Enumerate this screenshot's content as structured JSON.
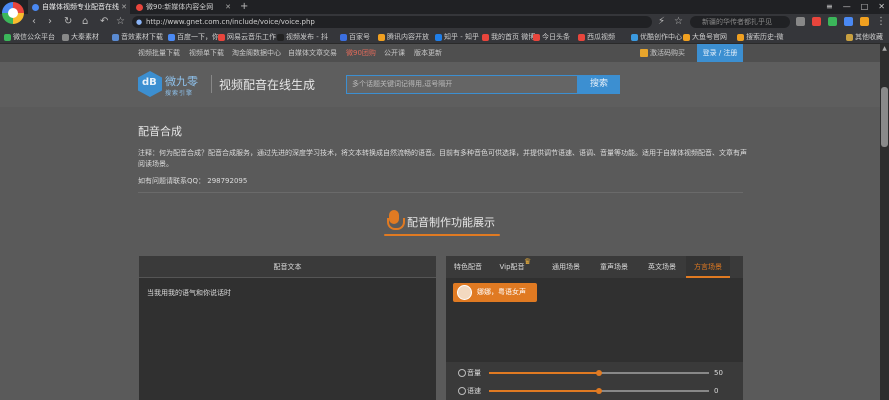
{
  "browser": {
    "tabs": [
      {
        "label": "自媒体视频专业配音在线",
        "active": true
      },
      {
        "label": "微90:新媒体内容全网",
        "active": false
      }
    ],
    "url": "http://www.gnet.com.cn/include/voice/voice.php",
    "search_placeholder": "新疆的华传者都扎乎见",
    "bookmarks": [
      {
        "label": "微信公众平台",
        "color": "#3bb65a"
      },
      {
        "label": "大秦素材",
        "color": "#888888"
      },
      {
        "label": "音效素材下载",
        "color": "#5a8ad1"
      },
      {
        "label": "百度一下，你",
        "color": "#4a89f3"
      },
      {
        "label": "网易云音乐工作",
        "color": "#e8453c"
      },
      {
        "label": "视频发布 - 抖",
        "color": "#222222"
      },
      {
        "label": "百家号",
        "color": "#3b6fe0"
      },
      {
        "label": "腾讯内容开放",
        "color": "#f0a020"
      },
      {
        "label": "知乎 - 知乎",
        "color": "#1f7ee8"
      },
      {
        "label": "我的首页 微博",
        "color": "#e8453c"
      },
      {
        "label": "今日头条",
        "color": "#e8453c"
      },
      {
        "label": "西瓜视频",
        "color": "#e8453c"
      },
      {
        "label": "优酷创作中心",
        "color": "#3b9ae0"
      },
      {
        "label": "大鱼号官网",
        "color": "#f0a020"
      },
      {
        "label": "搜索历史-微",
        "color": "#f0a020"
      },
      {
        "label": "其他收藏",
        "color": "#c8a040"
      }
    ]
  },
  "site": {
    "top_links": [
      {
        "label": "视频批量下载",
        "hot": false
      },
      {
        "label": "视频单下载",
        "hot": false
      },
      {
        "label": "淘金阁数据中心",
        "hot": false
      },
      {
        "label": "自媒体文章交易",
        "hot": false
      },
      {
        "label": "微90团购",
        "hot": true
      },
      {
        "label": "公开课",
        "hot": false
      },
      {
        "label": "版本更新",
        "hot": false
      }
    ],
    "vip_label": "激活码购买",
    "login_label": "登录 / 注册",
    "brand_name": "微九零",
    "brand_sub": "搜索引擎",
    "page_title": "视频配音在线生成",
    "search_placeholder": "多个话题关键词记得用,逗号隔开",
    "search_button": "搜索"
  },
  "content": {
    "section_title": "配音合成",
    "note": "注释：何为配音合成？配音合成服务，通过先进的深度学习技术，将文本转换成自然流畅的语音。目前有多种音色可供选择，并提供调节语速、语调、音量等功能。适用于自媒体视频配音、文章有声阅读场景。",
    "contact": "如有问题请联系QQ： 298792095",
    "feature_title": "配音制作功能展示",
    "text_panel_title": "配音文本",
    "text_panel_content": "当我用我的语气和你说话时",
    "voice_tabs": [
      {
        "label": "特色配音",
        "active": false
      },
      {
        "label": "Vip配音",
        "active": false
      },
      {
        "label": "通用场景",
        "active": false
      },
      {
        "label": "童声场景",
        "active": false
      },
      {
        "label": "英文场景",
        "active": false
      },
      {
        "label": "方言场景",
        "active": true
      }
    ],
    "selected_voice": "娜娜，粤语女声",
    "sliders": [
      {
        "label": "音量",
        "value": 50,
        "max": 100
      },
      {
        "label": "语速",
        "value": 0,
        "min": -500,
        "max": 500
      }
    ]
  },
  "colors": {
    "accent": "#e07a22",
    "brand_blue": "#3c8fd1"
  }
}
